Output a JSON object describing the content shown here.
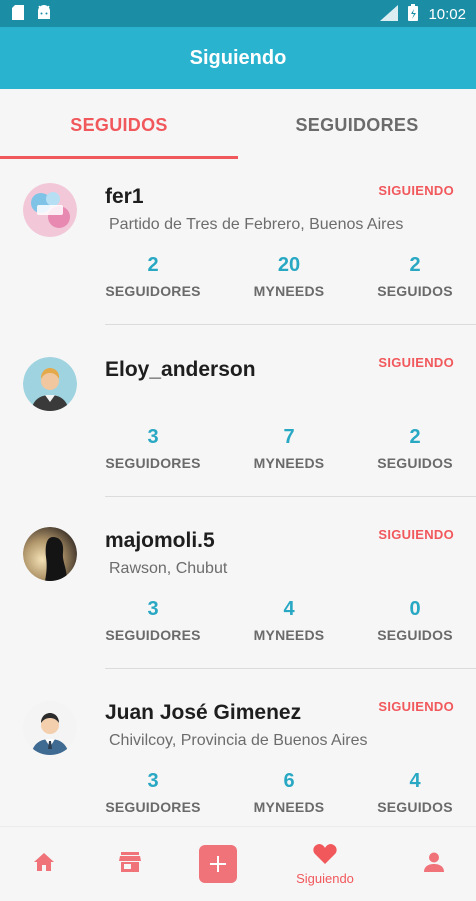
{
  "status_bar": {
    "time": "10:02"
  },
  "app_bar": {
    "title": "Siguiendo"
  },
  "tabs": [
    {
      "label": "SEGUIDOS",
      "active": true
    },
    {
      "label": "SEGUIDORES",
      "active": false
    }
  ],
  "users": [
    {
      "username": "fer1",
      "location": "Partido de Tres de Febrero, Buenos Aires",
      "button": "SIGUIENDO",
      "stats": [
        {
          "value": "2",
          "label": "SEGUIDORES"
        },
        {
          "value": "20",
          "label": "MYNEEDS"
        },
        {
          "value": "2",
          "label": "SEGUIDOS"
        }
      ]
    },
    {
      "username": "Eloy_anderson",
      "location": "",
      "button": "SIGUIENDO",
      "stats": [
        {
          "value": "3",
          "label": "SEGUIDORES"
        },
        {
          "value": "7",
          "label": "MYNEEDS"
        },
        {
          "value": "2",
          "label": "SEGUIDOS"
        }
      ]
    },
    {
      "username": "majomoli.5",
      "location": "Rawson, Chubut",
      "button": "SIGUIENDO",
      "stats": [
        {
          "value": "3",
          "label": "SEGUIDORES"
        },
        {
          "value": "4",
          "label": "MYNEEDS"
        },
        {
          "value": "0",
          "label": "SEGUIDOS"
        }
      ]
    },
    {
      "username": "Juan José Gimenez",
      "location": "Chivilcoy, Provincia de Buenos Aires",
      "button": "SIGUIENDO",
      "stats": [
        {
          "value": "3",
          "label": "SEGUIDORES"
        },
        {
          "value": "6",
          "label": "MYNEEDS"
        },
        {
          "value": "4",
          "label": "SEGUIDOS"
        }
      ]
    }
  ],
  "bottom_nav": [
    {
      "icon": "home-icon"
    },
    {
      "icon": "store-icon"
    },
    {
      "icon": "add-icon"
    },
    {
      "icon": "heart-icon",
      "label": "Siguiendo",
      "active": true
    },
    {
      "icon": "profile-icon"
    }
  ],
  "colors": {
    "primary": "#29b3cf",
    "status_bar": "#1b8ea6",
    "accent": "#f1585c",
    "stat_number": "#29a8c4"
  }
}
